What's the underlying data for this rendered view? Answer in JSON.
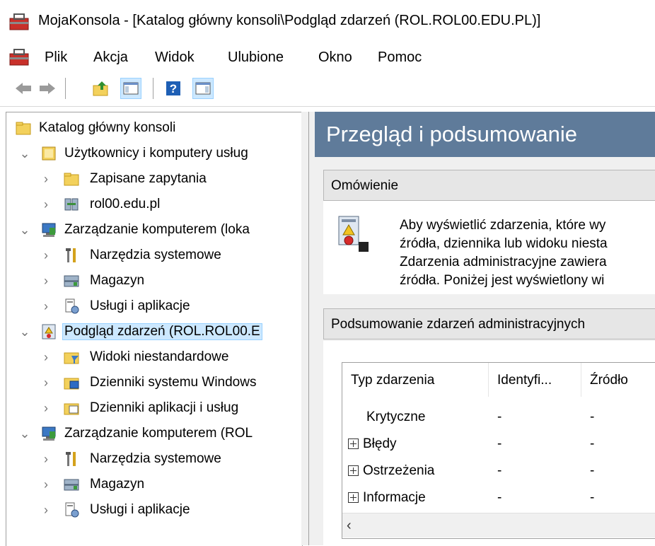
{
  "window": {
    "title": "MojaKonsola - [Katalog główny konsoli\\Podgląd zdarzeń (ROL.ROL00.EDU.PL)]"
  },
  "menu": [
    "Plik",
    "Akcja",
    "Widok",
    "Ulubione",
    "Okno",
    "Pomoc"
  ],
  "toolbar": {
    "icons": [
      "back-arrow-icon",
      "forward-arrow-icon",
      "up-folder-icon",
      "show-hide-tree-icon",
      "help-icon",
      "show-hide-action-pane-icon"
    ]
  },
  "tree": [
    {
      "label": "Katalog główny konsoli",
      "icon": "folder-icon",
      "level": 0,
      "state": "none"
    },
    {
      "label": "Użytkownicy i komputery usług",
      "icon": "ad-users-icon",
      "level": 1,
      "state": "expanded"
    },
    {
      "label": "Zapisane zapytania",
      "icon": "folder-icon",
      "level": 2,
      "state": "collapsed"
    },
    {
      "label": "rol00.edu.pl",
      "icon": "domain-icon",
      "level": 2,
      "state": "collapsed"
    },
    {
      "label": "Zarządzanie komputerem (loka",
      "icon": "computer-management-icon",
      "level": 1,
      "state": "expanded"
    },
    {
      "label": "Narzędzia systemowe",
      "icon": "tools-icon",
      "level": 2,
      "state": "collapsed"
    },
    {
      "label": "Magazyn",
      "icon": "storage-icon",
      "level": 2,
      "state": "collapsed"
    },
    {
      "label": "Usługi i aplikacje",
      "icon": "services-icon",
      "level": 2,
      "state": "collapsed"
    },
    {
      "label": "Podgląd zdarzeń (ROL.ROL00.E",
      "icon": "event-viewer-icon",
      "level": 1,
      "state": "expanded",
      "selected": true
    },
    {
      "label": "Widoki niestandardowe",
      "icon": "custom-views-icon",
      "level": 2,
      "state": "collapsed"
    },
    {
      "label": "Dzienniki systemu Windows",
      "icon": "windows-logs-icon",
      "level": 2,
      "state": "collapsed"
    },
    {
      "label": "Dzienniki aplikacji i usług",
      "icon": "app-logs-icon",
      "level": 2,
      "state": "collapsed"
    },
    {
      "label": "Zarządzanie komputerem (ROL",
      "icon": "computer-management-icon",
      "level": 1,
      "state": "expanded"
    },
    {
      "label": "Narzędzia systemowe",
      "icon": "tools-icon",
      "level": 2,
      "state": "collapsed"
    },
    {
      "label": "Magazyn",
      "icon": "storage-icon",
      "level": 2,
      "state": "collapsed"
    },
    {
      "label": "Usługi i aplikacje",
      "icon": "services-icon",
      "level": 2,
      "state": "collapsed"
    }
  ],
  "main": {
    "header": "Przegląd i podsumowanie",
    "overview": {
      "title": "Omówienie",
      "lines": [
        "Aby wyświetlić zdarzenia, które wy",
        "źródła, dziennika lub widoku niesta",
        "Zdarzenia administracyjne zawiera",
        "źródła. Poniżej jest wyświetlony wi"
      ]
    },
    "summary": {
      "title": "Podsumowanie zdarzeń administracyjnych",
      "columns": [
        "Typ zdarzenia",
        "Identyfi...",
        "Źródło"
      ],
      "rows": [
        {
          "type": "Krytyczne",
          "id": "-",
          "source": "-",
          "expandable": false
        },
        {
          "type": "Błędy",
          "id": "-",
          "source": "-",
          "expandable": true
        },
        {
          "type": "Ostrzeżenia",
          "id": "-",
          "source": "-",
          "expandable": true
        },
        {
          "type": "Informacje",
          "id": "-",
          "source": "-",
          "expandable": true
        }
      ],
      "scroll_left": "‹"
    }
  }
}
